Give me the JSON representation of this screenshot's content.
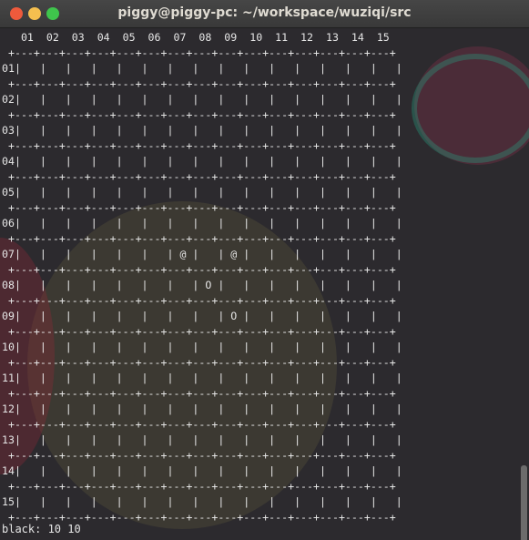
{
  "window": {
    "title": "piggy@piggy-pc: ~/workspace/wuziqi/src"
  },
  "terminal": {
    "board_text": "   01  02  03  04  05  06  07  08  09  10  11  12  13  14  15\n +---+---+---+---+---+---+---+---+---+---+---+---+---+---+---+\n01|   |   |   |   |   |   |   |   |   |   |   |   |   |   |   |\n +---+---+---+---+---+---+---+---+---+---+---+---+---+---+---+\n02|   |   |   |   |   |   |   |   |   |   |   |   |   |   |   |\n +---+---+---+---+---+---+---+---+---+---+---+---+---+---+---+\n03|   |   |   |   |   |   |   |   |   |   |   |   |   |   |   |\n +---+---+---+---+---+---+---+---+---+---+---+---+---+---+---+\n04|   |   |   |   |   |   |   |   |   |   |   |   |   |   |   |\n +---+---+---+---+---+---+---+---+---+---+---+---+---+---+---+\n05|   |   |   |   |   |   |   |   |   |   |   |   |   |   |   |\n +---+---+---+---+---+---+---+---+---+---+---+---+---+---+---+\n06|   |   |   |   |   |   |   |   |   |   |   |   |   |   |   |\n +---+---+---+---+---+---+---+---+---+---+---+---+---+---+---+\n07|   |   |   |   |   |   | @ |   | @ |   |   |   |   |   |   |\n +---+---+---+---+---+---+---+---+---+---+---+---+---+---+---+\n08|   |   |   |   |   |   |   | O |   |   |   |   |   |   |   |\n +---+---+---+---+---+---+---+---+---+---+---+---+---+---+---+\n09|   |   |   |   |   |   |   |   | O |   |   |   |   |   |   |\n +---+---+---+---+---+---+---+---+---+---+---+---+---+---+---+\n10|   |   |   |   |   |   |   |   |   |   |   |   |   |   |   |\n +---+---+---+---+---+---+---+---+---+---+---+---+---+---+---+\n11|   |   |   |   |   |   |   |   |   |   |   |   |   |   |   |\n +---+---+---+---+---+---+---+---+---+---+---+---+---+---+---+\n12|   |   |   |   |   |   |   |   |   |   |   |   |   |   |   |\n +---+---+---+---+---+---+---+---+---+---+---+---+---+---+---+\n13|   |   |   |   |   |   |   |   |   |   |   |   |   |   |   |\n +---+---+---+---+---+---+---+---+---+---+---+---+---+---+---+\n14|   |   |   |   |   |   |   |   |   |   |   |   |   |   |   |\n +---+---+---+---+---+---+---+---+---+---+---+---+---+---+---+\n15|   |   |   |   |   |   |   |   |   |   |   |   |   |   |   |\n +---+---+---+---+---+---+---+---+---+---+---+---+---+---+---+",
    "prompt_line": "black: 10 10"
  },
  "icons": {
    "close": "close-icon",
    "minimize": "minimize-icon",
    "maximize": "maximize-icon"
  },
  "colors": {
    "close": "#ee5a3c",
    "minimize": "#f4bf4f",
    "maximize": "#3fc54c",
    "terminal_text": "#e6e6e6"
  }
}
